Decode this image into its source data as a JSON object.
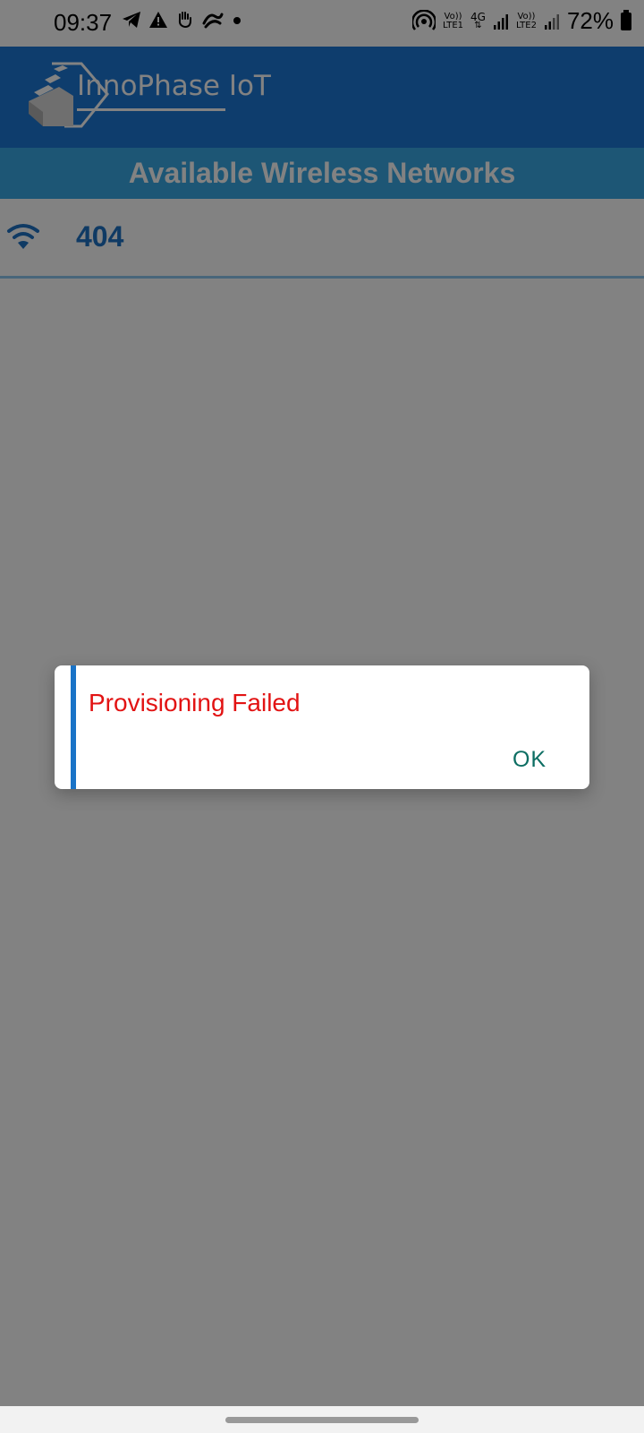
{
  "status_bar": {
    "time": "09:37",
    "left_icons": [
      "telegram-icon",
      "warning-icon",
      "hand-icon",
      "app-icon",
      "notification-dot-icon"
    ],
    "sim1_label_top": "Vo))",
    "sim1_label_bottom": "LTE1",
    "network_type": "4G",
    "sim2_label_top": "Vo))",
    "sim2_label_bottom": "LTE2",
    "battery_percent": "72%"
  },
  "app_bar": {
    "logo_text": "InnoPhase IoT",
    "brand_color": "#1c79d6"
  },
  "networks": {
    "header": "Available Wireless Networks",
    "items": [
      {
        "ssid": "404",
        "icon": "wifi-icon"
      }
    ]
  },
  "dialog": {
    "message": "Provisioning Failed",
    "ok_label": "OK",
    "message_color": "#e21313",
    "ok_color": "#0d6e63"
  }
}
